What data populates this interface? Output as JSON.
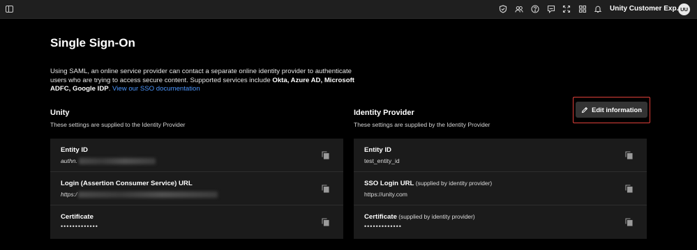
{
  "topbar": {
    "org_name": "Unity Customer Exp...",
    "avatar_initials": "UU",
    "icons": [
      "sidebar-toggle-icon",
      "shield-icon",
      "users-icon",
      "help-icon",
      "feedback-icon",
      "fullscreen-icon",
      "apps-grid-icon",
      "bell-icon"
    ]
  },
  "page": {
    "title": "Single Sign-On",
    "intro_part1": "Using SAML, an online service provider can contact a separate online identity provider to authenticate users who are trying to access secure content. Supported services include ",
    "intro_bold": "Okta, Azure AD, Microsoft ADFC, Google IDP",
    "intro_part2": ". ",
    "doc_link": "View our SSO documentation",
    "edit_button": "Edit information"
  },
  "unity": {
    "title": "Unity",
    "subtitle": "These settings are supplied to the Identity Provider",
    "rows": [
      {
        "label": "Entity ID",
        "value": "authn."
      },
      {
        "label": "Login (Assertion Consumer Service) URL",
        "value": "https:/"
      },
      {
        "label": "Certificate",
        "value": "•••••••••••••"
      }
    ]
  },
  "idp": {
    "title": "Identity Provider",
    "subtitle": "These settings are supplied by the Identity Provider",
    "rows": [
      {
        "label": "Entity ID",
        "sub": "",
        "value": "test_entity_id"
      },
      {
        "label": "SSO Login URL",
        "sub": " (supplied by identity provider)",
        "value": "https://unity.com"
      },
      {
        "label": "Certificate",
        "sub": " (supplied by identity provider)",
        "value": "•••••••••••••"
      }
    ]
  },
  "colors": {
    "background": "#000000",
    "topbar": "#1f1f1f",
    "panel": "#1b1b1b",
    "link": "#4c97ff",
    "highlight": "#e0403a"
  }
}
